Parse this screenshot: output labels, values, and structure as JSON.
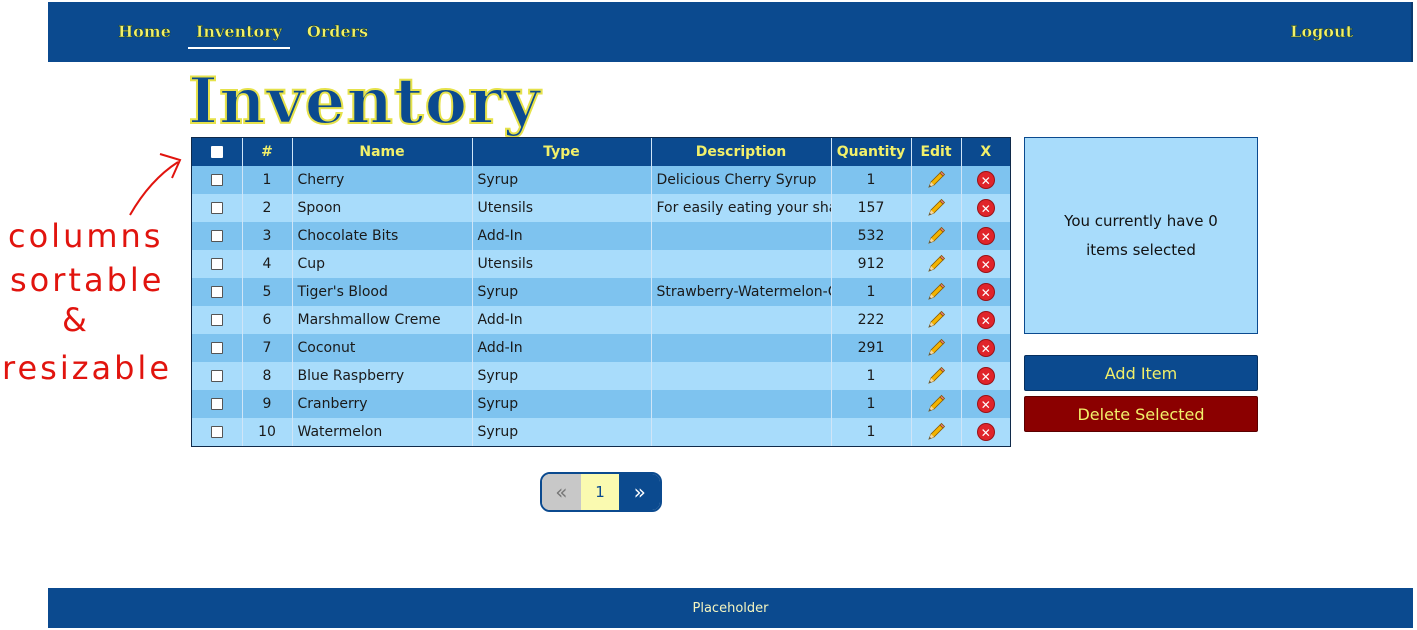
{
  "nav": {
    "items": [
      {
        "label": "Home"
      },
      {
        "label": "Inventory"
      },
      {
        "label": "Orders"
      }
    ],
    "logout_label": "Logout"
  },
  "page": {
    "title": "Inventory"
  },
  "annotations": {
    "line1": "columns",
    "line2": "sortable",
    "line3": "&",
    "line4": "resizable"
  },
  "table": {
    "headers": {
      "num": "#",
      "name": "Name",
      "type": "Type",
      "description": "Description",
      "quantity": "Quantity",
      "edit": "Edit",
      "delete": "X"
    },
    "rows": [
      {
        "num": "1",
        "name": "Cherry",
        "type": "Syrup",
        "description": "Delicious Cherry Syrup",
        "quantity": "1"
      },
      {
        "num": "2",
        "name": "Spoon",
        "type": "Utensils",
        "description": "For easily eating your shave",
        "quantity": "157"
      },
      {
        "num": "3",
        "name": "Chocolate Bits",
        "type": "Add-In",
        "description": "",
        "quantity": "532"
      },
      {
        "num": "4",
        "name": "Cup",
        "type": "Utensils",
        "description": "",
        "quantity": "912"
      },
      {
        "num": "5",
        "name": "Tiger's Blood",
        "type": "Syrup",
        "description": "Strawberry-Watermelon-Co",
        "quantity": "1"
      },
      {
        "num": "6",
        "name": "Marshmallow Creme",
        "type": "Add-In",
        "description": "",
        "quantity": "222"
      },
      {
        "num": "7",
        "name": "Coconut",
        "type": "Add-In",
        "description": "",
        "quantity": "291"
      },
      {
        "num": "8",
        "name": "Blue Raspberry",
        "type": "Syrup",
        "description": "",
        "quantity": "1"
      },
      {
        "num": "9",
        "name": "Cranberry",
        "type": "Syrup",
        "description": "",
        "quantity": "1"
      },
      {
        "num": "10",
        "name": "Watermelon",
        "type": "Syrup",
        "description": "",
        "quantity": "1"
      }
    ]
  },
  "selection": {
    "message": "You currently have 0 items selected"
  },
  "actions": {
    "add_label": "Add Item",
    "delete_label": "Delete Selected"
  },
  "pagination": {
    "prev": "«",
    "current": "1",
    "next": "»"
  },
  "footer": {
    "text": "Placeholder"
  },
  "icons": {
    "edit": "pencil-icon",
    "delete": "x-circle-icon"
  },
  "colors": {
    "primary": "#0b4a8f",
    "accent_text": "#f2f06a",
    "row_odd": "#7ec3ef",
    "row_even": "#a8dcfb",
    "danger": "#8b0000",
    "annotation": "#e1140e"
  }
}
